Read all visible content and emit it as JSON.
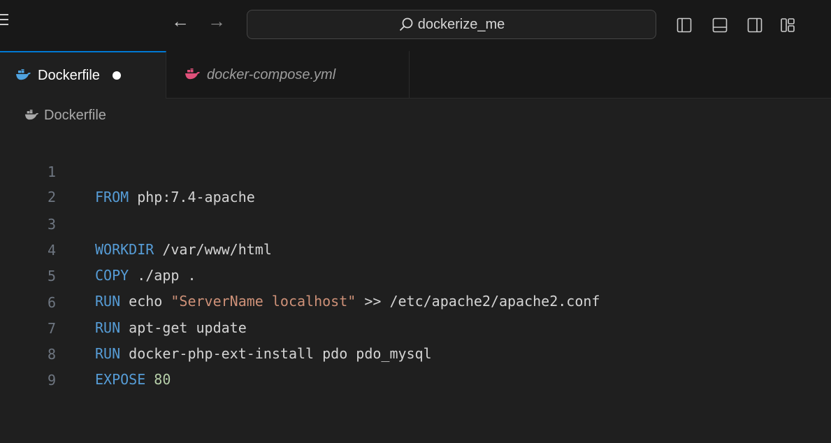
{
  "titlebar": {
    "search_text": "dockerize_me"
  },
  "tabs": [
    {
      "label": "Dockerfile",
      "active": true,
      "modified": true
    },
    {
      "label": "docker-compose.yml",
      "active": false,
      "modified": false
    }
  ],
  "breadcrumb": {
    "file": "Dockerfile"
  },
  "editor": {
    "line_numbers": [
      "1",
      "2",
      "3",
      "4",
      "5",
      "6",
      "7",
      "8",
      "9"
    ],
    "lines": [
      {
        "kw": "FROM",
        "rest": " php:7.4-apache"
      },
      {
        "kw": "",
        "rest": ""
      },
      {
        "kw": "WORKDIR",
        "rest": " /var/www/html"
      },
      {
        "kw": "COPY",
        "rest": " ./app ."
      },
      {
        "kw": "RUN",
        "rest": " echo ",
        "str": "\"ServerName localhost\"",
        "rest2": " >> /etc/apache2/apache2.conf"
      },
      {
        "kw": "RUN",
        "rest": " apt-get update"
      },
      {
        "kw": "RUN",
        "rest": " docker-php-ext-install pdo pdo_mysql"
      },
      {
        "kw": "EXPOSE",
        "num": " 80"
      },
      {
        "kw": "",
        "rest": ""
      }
    ]
  },
  "colors": {
    "accent": "#0078d4",
    "keyword": "#569cd6",
    "string": "#ce9178",
    "number": "#b5cea8",
    "docker_blue": "#4fa3e0",
    "compose_pink": "#e0507a"
  }
}
